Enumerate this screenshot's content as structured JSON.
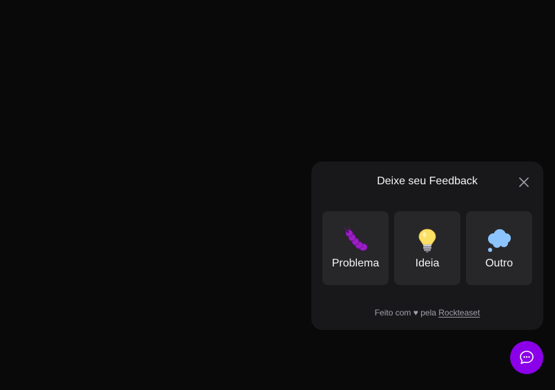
{
  "widget": {
    "title": "Deixe seu Feedback",
    "close_icon": "close-icon",
    "options": [
      {
        "label": "Problema",
        "icon": "bug-icon"
      },
      {
        "label": "Ideia",
        "icon": "lightbulb-icon"
      },
      {
        "label": "Outro",
        "icon": "thought-bubble-icon"
      }
    ],
    "footer": {
      "prefix": "Feito com",
      "heart": "♥",
      "middle": "pela",
      "link": "Rockteaset"
    }
  },
  "fab": {
    "icon": "chat-bubble-icon",
    "color": "#8b00e8"
  },
  "colors": {
    "background": "#09090a",
    "panel": "#18181b",
    "card": "#27272a",
    "accent": "#8b00e8"
  }
}
